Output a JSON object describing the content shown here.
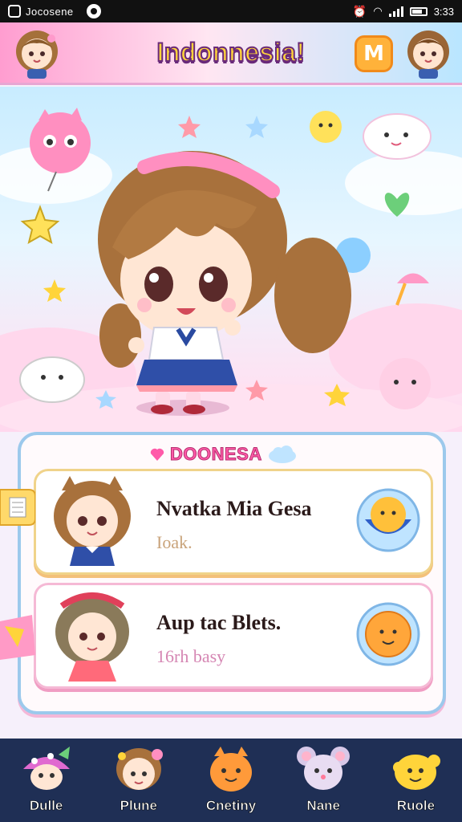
{
  "status_bar": {
    "brand": "Jocosene",
    "time": "3:33"
  },
  "header": {
    "title": "Indonnesia!",
    "menu_button": "M"
  },
  "panel": {
    "title": "DOONESA",
    "cards": [
      {
        "name": "Nvatka Mia Gesa",
        "subtitle": "Ioak."
      },
      {
        "name": "Aup tac Blets.",
        "subtitle": "16rh basy"
      }
    ]
  },
  "nav": {
    "items": [
      {
        "label": "Dulle",
        "icon": "mushroom-icon"
      },
      {
        "label": "Plune",
        "icon": "girl-face-icon"
      },
      {
        "label": "Cnetiny",
        "icon": "orange-creature-icon"
      },
      {
        "label": "Nane",
        "icon": "mouse-icon"
      },
      {
        "label": "Ruole",
        "icon": "yellow-blob-icon"
      }
    ]
  },
  "colors": {
    "header_pink": "#ff9dd0",
    "title_yellow": "#ffd43a",
    "nav_bg": "#1f2f55",
    "panel_border": "#9cc9ec"
  }
}
